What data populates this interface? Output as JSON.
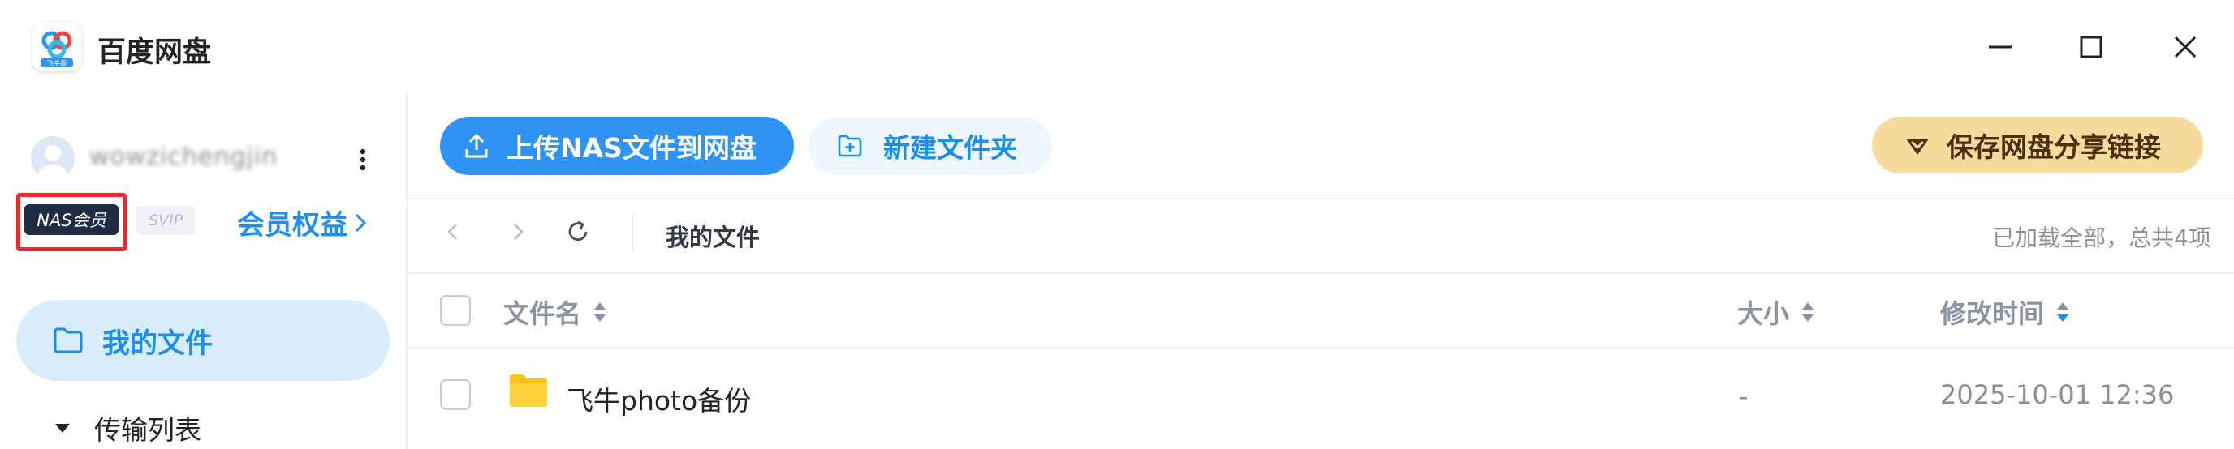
{
  "window": {
    "title": "百度网盘",
    "logo_caption": "飞牛版",
    "controls": [
      "minimize-icon",
      "maximize-icon",
      "close-icon"
    ]
  },
  "sidebar": {
    "username": "wowzichengjin",
    "badges": {
      "nas": "NAS会员",
      "svip": "SVIP"
    },
    "member_link": "会员权益",
    "nav": [
      {
        "label": "我的文件",
        "icon": "folder-icon",
        "active": true
      },
      {
        "label": "传输列表",
        "icon": "triangle-down-icon",
        "active": false
      }
    ]
  },
  "toolbar": {
    "upload_label": "上传NAS文件到网盘",
    "new_folder_label": "新建文件夹",
    "save_share_label": "保存网盘分享链接"
  },
  "navbar": {
    "breadcrumb": "我的文件",
    "status": "已加载全部，总共4项"
  },
  "table": {
    "columns": [
      "文件名",
      "大小",
      "修改时间"
    ],
    "rows": [
      {
        "name": "飞牛photo备份",
        "size": "-",
        "modified": "2025-10-01 12:36",
        "type": "folder"
      }
    ]
  },
  "colors": {
    "accent": "#1b8ef2",
    "upload_button": "#2e93f5",
    "save_share_button": "#f5dc9c",
    "highlight": "#e82c2c"
  }
}
